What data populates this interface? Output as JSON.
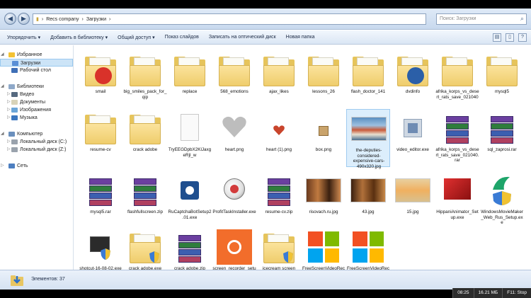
{
  "address": {
    "crumbs": [
      "Recs company",
      "Загрузки"
    ],
    "search_placeholder": "Поиск: Загрузки"
  },
  "toolbar": {
    "organize": "Упорядочить",
    "add_library": "Добавить в библиотеку",
    "share": "Общий доступ",
    "slideshow": "Показ слайдов",
    "burn": "Записать на оптический диск",
    "new_folder": "Новая папка"
  },
  "nav": {
    "favorites": "Избранное",
    "downloads": "Загрузки",
    "desktop": "Рабочий стол",
    "libraries": "Библиотеки",
    "video": "Видео",
    "documents": "Документы",
    "images": "Изображения",
    "music": "Музыка",
    "computer": "Компьютер",
    "disk_c": "Локальный диск (C:)",
    "disk_z": "Локальный диск (Z:)",
    "network": "Сеть"
  },
  "files": [
    {
      "name": "smail",
      "kind": "folder",
      "inner": "#d9322a"
    },
    {
      "name": "big_smiles_pack_for_qip",
      "kind": "folder",
      "inner": ""
    },
    {
      "name": "replace",
      "kind": "folder",
      "inner": ""
    },
    {
      "name": "568_emotions",
      "kind": "folder",
      "inner": ""
    },
    {
      "name": "ajax_likes",
      "kind": "folder",
      "inner": ""
    },
    {
      "name": "lessons_26",
      "kind": "folder",
      "inner": ""
    },
    {
      "name": "flash_doctor_141",
      "kind": "folder",
      "inner": ""
    },
    {
      "name": "dvdinfo",
      "kind": "folder",
      "inner": "#2b5fa8"
    },
    {
      "name": "afrika_korps_vs_desert_rats_save_021040",
      "kind": "folder",
      "inner": ""
    },
    {
      "name": "mysql5",
      "kind": "folder",
      "inner": ""
    },
    {
      "name": "resume-cv",
      "kind": "folder",
      "inner": ""
    },
    {
      "name": "crack adobe",
      "kind": "folder",
      "inner": ""
    },
    {
      "name": "TryEEGDpbX2KlJaxgeRjl_w",
      "kind": "page",
      "inner": ""
    },
    {
      "name": "heart.png",
      "kind": "heart-grey",
      "inner": ""
    },
    {
      "name": "heart (1).png",
      "kind": "heart-red",
      "inner": ""
    },
    {
      "name": "box.png",
      "kind": "box",
      "inner": ""
    },
    {
      "name": "the-deputies-considered-expensive-cars-490x320.jpg",
      "kind": "photo-cars",
      "inner": "",
      "selected": true
    },
    {
      "name": "video_editor.exe",
      "kind": "exe-video",
      "inner": ""
    },
    {
      "name": "afrika_korps_vs_desert_rats_save_021040.rar",
      "kind": "rar",
      "inner": ""
    },
    {
      "name": "sql_zaprosi.rar",
      "kind": "rar",
      "inner": ""
    },
    {
      "name": "mysql5.rar",
      "kind": "rar",
      "inner": ""
    },
    {
      "name": "flashfullscreen.zip",
      "kind": "rar",
      "inner": ""
    },
    {
      "name": "RuCaptchaBotSetup2.01.exe",
      "kind": "exe-bot",
      "inner": ""
    },
    {
      "name": "ProfitTaskInstaller.exe",
      "kind": "exe-globe",
      "inner": ""
    },
    {
      "name": "resume-cv.zip",
      "kind": "rar",
      "inner": ""
    },
    {
      "name": "risovach.ru.jpg",
      "kind": "photo-meme",
      "inner": ""
    },
    {
      "name": "43.jpg",
      "kind": "photo-meme2",
      "inner": ""
    },
    {
      "name": "15.jpg",
      "kind": "photo-beach",
      "inner": ""
    },
    {
      "name": "HippaniAnimator_Setup.exe",
      "kind": "exe-box",
      "inner": ""
    },
    {
      "name": "WindowsMovieMaker_Web_Rus_Setup.exe",
      "kind": "exe-wmm",
      "inner": ""
    },
    {
      "name": "shotcut-16-08-02.exe",
      "kind": "exe-shotcut",
      "inner": ""
    },
    {
      "name": "crack adobe.exe",
      "kind": "folder-shield",
      "inner": ""
    },
    {
      "name": "crack adobe.zip",
      "kind": "rar",
      "inner": ""
    },
    {
      "name": "screen_recorder_setup.exe",
      "kind": "exe-screenrec",
      "inner": ""
    },
    {
      "name": "icecream screen recorder pro v3",
      "kind": "folder-shield",
      "inner": ""
    },
    {
      "name": "FreeScreenVideoRecorder 3.0.42.7",
      "kind": "ms",
      "inner": ""
    },
    {
      "name": "FreeScreenVideoRecorder.exe",
      "kind": "ms",
      "inner": ""
    }
  ],
  "status": {
    "count_text": "Элементов: 37"
  },
  "recorder": {
    "time": "08:25",
    "size": "16.21 МБ",
    "hotkey": "F11: Stop"
  }
}
